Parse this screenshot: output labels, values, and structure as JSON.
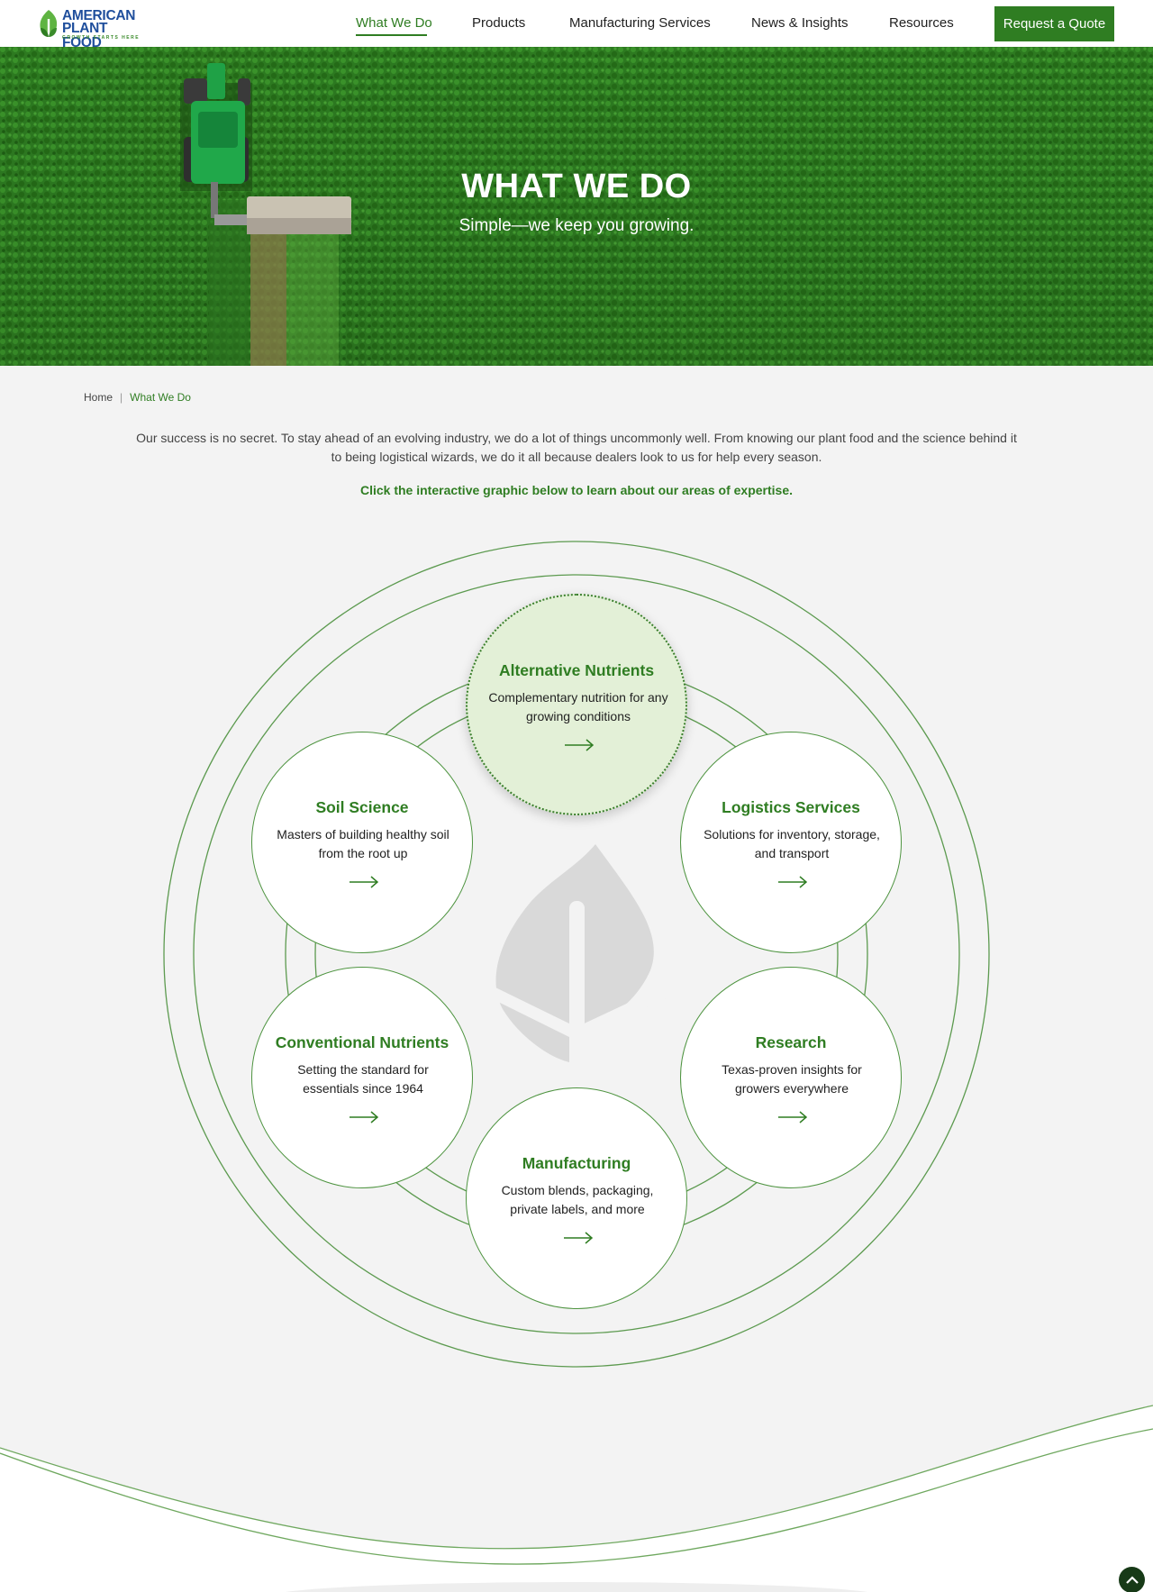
{
  "brand": {
    "line1": "AMERICAN",
    "line2": "PLANT FOOD",
    "tagline": "GROWTH STARTS HERE",
    "colors": {
      "blue": "#1f4e9c",
      "green": "#2f7d22",
      "light_green": "#5fb442"
    }
  },
  "nav": {
    "items": [
      {
        "label": "What We Do",
        "active": true
      },
      {
        "label": "Products"
      },
      {
        "label": "Manufacturing Services"
      },
      {
        "label": "News & Insights"
      },
      {
        "label": "Resources"
      }
    ],
    "cta": "Request a Quote"
  },
  "hero": {
    "title": "WHAT WE DO",
    "subtitle": "Simple—we keep you growing."
  },
  "breadcrumb": {
    "home": "Home",
    "separator": "|",
    "current": "What We Do"
  },
  "intro": {
    "text": "Our success is no secret. To stay ahead of an evolving industry, we do a lot of things uncommonly well. From knowing our plant food and the science behind it to being logistical wizards, we do it all because dealers look to us for help every season.",
    "cta": "Click the interactive graphic below to learn about our areas of expertise."
  },
  "graphic": {
    "center_icon": "leaf-icon",
    "nodes": [
      {
        "title": "Alternative Nutrients",
        "desc": "Complementary nutrition for any growing conditions",
        "active": true
      },
      {
        "title": "Soil Science",
        "desc": "Masters of building healthy soil from the root up"
      },
      {
        "title": "Logistics Services",
        "desc": "Solutions for inventory, storage, and transport"
      },
      {
        "title": "Conventional Nutrients",
        "desc": "Setting the standard for essentials since 1964"
      },
      {
        "title": "Research",
        "desc": "Texas-proven insights for growers everywhere"
      },
      {
        "title": "Manufacturing",
        "desc": "Custom blends, packaging, private labels, and more"
      }
    ]
  },
  "icons": {
    "arrow": "arrow-right-icon",
    "back_to_top": "chevron-up-icon"
  }
}
